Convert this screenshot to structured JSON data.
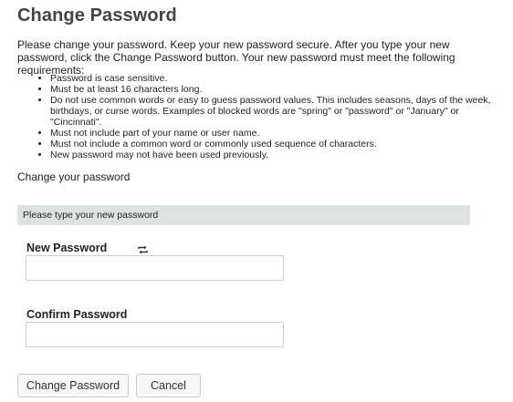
{
  "page": {
    "title": "Change Password",
    "intro": "Please change your password. Keep your new password secure. After you type your new password, click the Change Password button. Your new password must meet the following requirements:"
  },
  "requirements": [
    "Password is case sensitive.",
    "Must be at least 16 characters long.",
    "Do not use common words or easy to guess password values. This includes seasons, days of the week, birthdays, or curse words. Examples of blocked words are \"spring\" or \"password\" or \"January\" or \"Cincinnati\".",
    "Must not include part of your name or user name.",
    "Must not include a common word or commonly used sequence of characters.",
    "New password may not have been used previously."
  ],
  "form": {
    "section_caption": "Change your password",
    "instruction": "Please type your new password",
    "new_password": {
      "label": "New Password",
      "value": "",
      "placeholder": "",
      "toggle_icon": "refresh-icon"
    },
    "confirm_password": {
      "label": "Confirm Password",
      "value": "",
      "placeholder": ""
    }
  },
  "buttons": {
    "change_label": "Change Password",
    "cancel_label": "Cancel"
  }
}
